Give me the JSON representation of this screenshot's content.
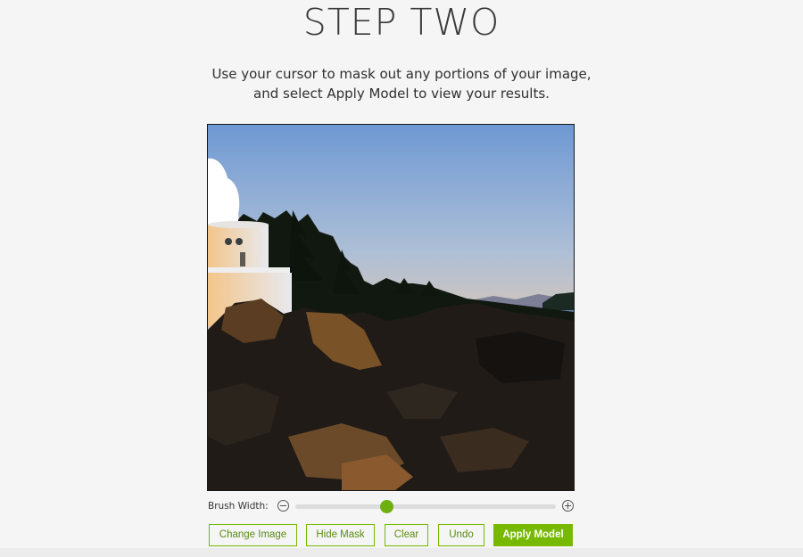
{
  "header": {
    "title": "STEP TWO",
    "line1": "Use your cursor to mask out any portions of your image,",
    "line2": "and select Apply Model to view your results."
  },
  "canvas": {
    "description_icon": "image-canvas"
  },
  "brush": {
    "label": "Brush Width:",
    "value_fraction": 0.35,
    "minus_icon": "zoom-out-icon",
    "plus_icon": "zoom-in-icon"
  },
  "toolbar": {
    "change_image": "Change Image",
    "hide_mask": "Hide Mask",
    "clear": "Clear",
    "undo": "Undo",
    "apply_model": "Apply Model"
  },
  "colors": {
    "accent": "#76b900",
    "background": "#f5f5f5"
  }
}
